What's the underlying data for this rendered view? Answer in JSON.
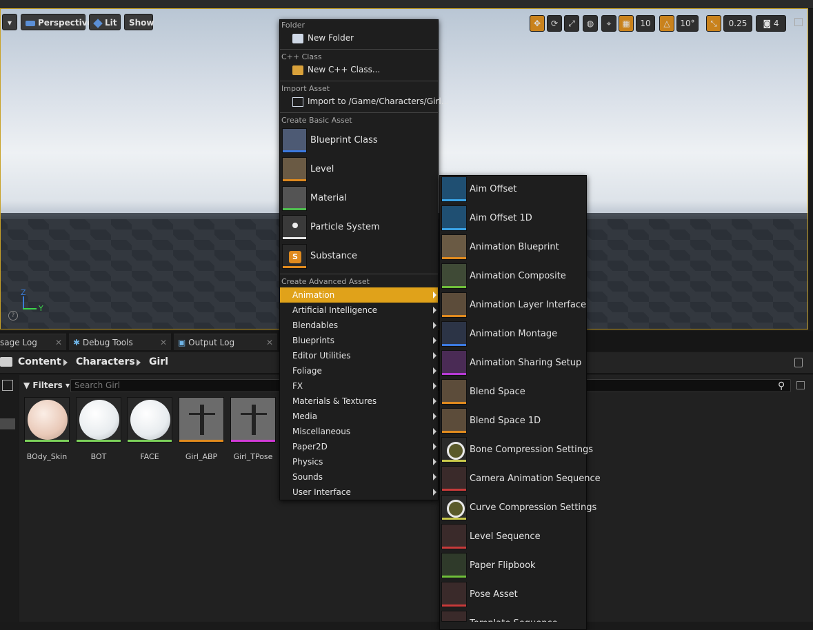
{
  "viewport": {
    "mode_dropdown": "▾",
    "perspective_label": "Perspective",
    "lit_label": "Lit",
    "show_label": "Show",
    "grid_snap_value": "10",
    "rotation_snap_value": "10°",
    "scale_snap_value": "0.25",
    "camera_speed_value": "4",
    "axis_z": "Z",
    "axis_y": "Y"
  },
  "bottom_tabs": [
    {
      "label": "sage Log"
    },
    {
      "label": "Debug Tools"
    },
    {
      "label": "Output Log"
    }
  ],
  "breadcrumb": [
    "Content",
    "Characters",
    "Girl"
  ],
  "filters_label": "Filters",
  "search_placeholder": "Search Girl",
  "assets": [
    {
      "name": "BOdy_Skin",
      "color": "#7bd05a"
    },
    {
      "name": "BOT",
      "color": "#7bd05a"
    },
    {
      "name": "FACE",
      "color": "#7bd05a"
    },
    {
      "name": "Girl_ABP",
      "color": "#e08a1e"
    },
    {
      "name": "Girl_TPose",
      "color": "#d13bd6"
    }
  ],
  "menu": {
    "sections": {
      "folder": "Folder",
      "cpp": "C++ Class",
      "import": "Import Asset",
      "basic": "Create Basic Asset",
      "advanced": "Create Advanced Asset"
    },
    "new_folder": "New Folder",
    "new_cpp": "New C++ Class...",
    "import_to": "Import to /Game/Characters/Girl...",
    "basic_items": [
      {
        "label": "Blueprint Class",
        "color": "#3c7ae0"
      },
      {
        "label": "Level",
        "color": "#e08a1e"
      },
      {
        "label": "Material",
        "color": "#4fc04f"
      },
      {
        "label": "Particle System",
        "color": "#e6e6e6"
      },
      {
        "label": "Substance",
        "color": "#e08a1e"
      }
    ],
    "advanced_items": [
      "Animation",
      "Artificial Intelligence",
      "Blendables",
      "Blueprints",
      "Editor Utilities",
      "Foliage",
      "FX",
      "Materials & Textures",
      "Media",
      "Miscellaneous",
      "Paper2D",
      "Physics",
      "Sounds",
      "User Interface"
    ]
  },
  "submenu": {
    "items": [
      {
        "label": "Aim Offset",
        "color": "#3aa3e6"
      },
      {
        "label": "Aim Offset 1D",
        "color": "#3aa3e6"
      },
      {
        "label": "Animation Blueprint",
        "color": "#e08a1e"
      },
      {
        "label": "Animation Composite",
        "color": "#6fbf3a"
      },
      {
        "label": "Animation Layer Interface",
        "color": "#e08a1e"
      },
      {
        "label": "Animation Montage",
        "color": "#3c7ae0"
      },
      {
        "label": "Animation Sharing Setup",
        "color": "#b83ad6"
      },
      {
        "label": "Blend Space",
        "color": "#e08a1e"
      },
      {
        "label": "Blend Space 1D",
        "color": "#e08a1e"
      },
      {
        "label": "Bone Compression Settings",
        "color": "#c8c84a"
      },
      {
        "label": "Camera Animation Sequence",
        "color": "#c83a3a"
      },
      {
        "label": "Curve Compression Settings",
        "color": "#c8c84a"
      },
      {
        "label": "Level Sequence",
        "color": "#c83a3a"
      },
      {
        "label": "Paper Flipbook",
        "color": "#6fbf3a"
      },
      {
        "label": "Pose Asset",
        "color": "#c83a3a"
      },
      {
        "label": "Template Sequence",
        "color": "#c83a3a"
      }
    ]
  }
}
